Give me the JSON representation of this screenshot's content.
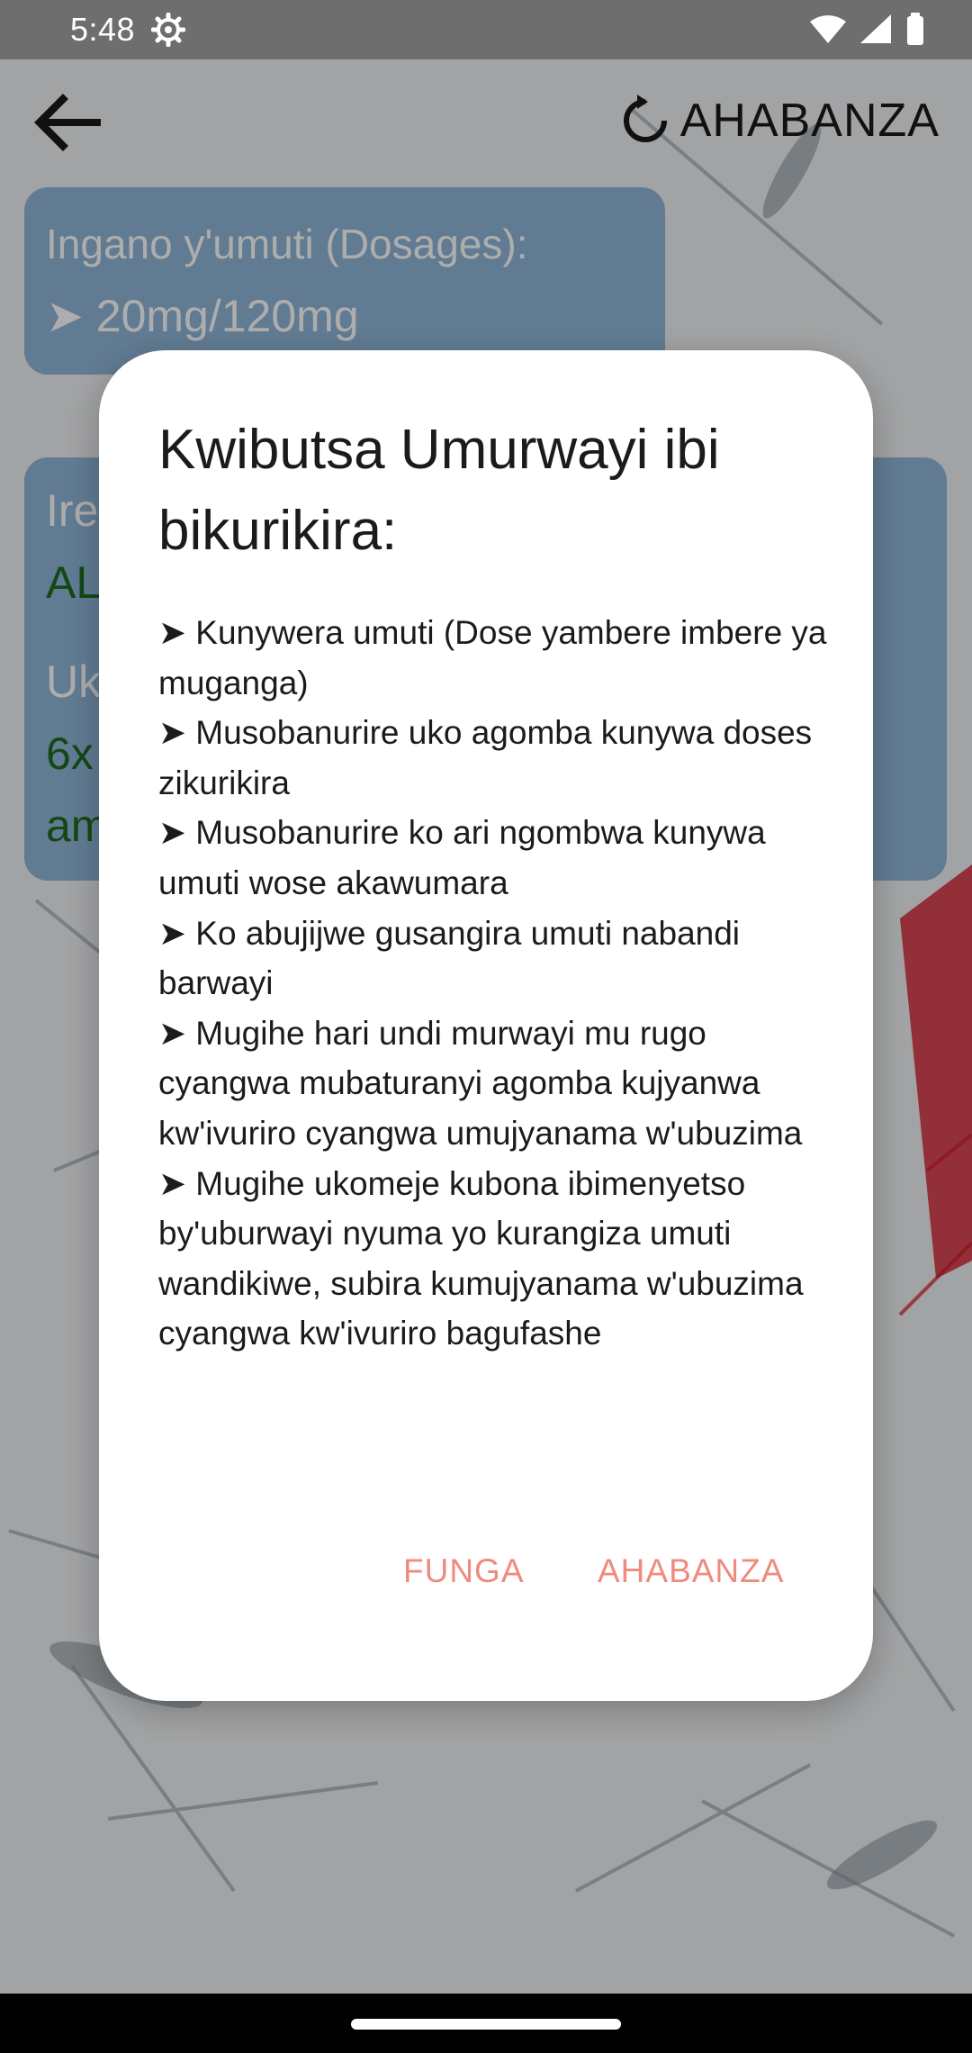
{
  "status_bar": {
    "time": "5:48"
  },
  "toolbar": {
    "restart_label": "AHABANZA"
  },
  "card_dosage": {
    "label": "Ingano y'umuti (Dosages):",
    "value": "➤ 20mg/120mg"
  },
  "card_info": {
    "line1": "Ire",
    "line2": "AL",
    "line3": "Uk",
    "line4": "6x",
    "line5": "am"
  },
  "dialog": {
    "title": "Kwibutsa Umurwayi ibi bikurikira:",
    "items": [
      "➤ Kunywera umuti (Dose yambere imbere ya muganga)",
      " ➤ Musobanurire uko agomba kunywa doses zikurikira",
      " ➤ Musobanurire ko ari ngombwa kunywa umuti wose akawumara",
      " ➤ Ko abujijwe gusangira umuti nabandi barwayi",
      " ➤ Mugihe hari undi murwayi mu rugo cyangwa mubaturanyi agomba kujyanwa kw'ivuriro cyangwa umujyanama w'ubuzima",
      " ➤ Mugihe ukomeje kubona ibimenyetso by'uburwayi nyuma yo kurangiza umuti wandikiwe, subira kumujyanama w'ubuzima cyangwa kw'ivuriro bagufashe"
    ],
    "close_label": "FUNGA",
    "restart_label": "AHABANZA"
  },
  "colors": {
    "accent": "#f08a7e",
    "card": "#8fb6d8",
    "green_text": "#1e6b20"
  }
}
